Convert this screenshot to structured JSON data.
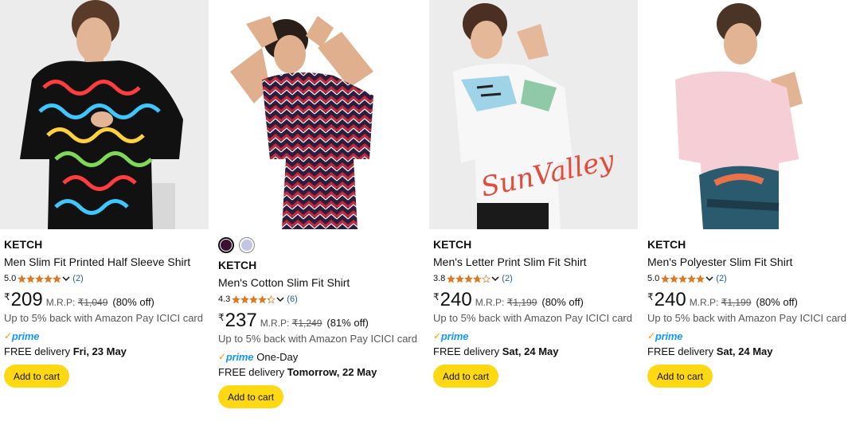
{
  "colors": {
    "accent_button": "#ffd814",
    "prime_blue": "#1399ff",
    "prime_tick": "#ff9900",
    "star": "#de7921",
    "link": "#2162a1"
  },
  "products": [
    {
      "brand": "KETCH",
      "title": "Men Slim Fit Printed Half Sleeve Shirt",
      "rating": "5.0",
      "rating_value": 5.0,
      "rating_count": "(2)",
      "currency": "₹",
      "price": "209",
      "mrp_label": "M.R.P:",
      "mrp": "₹1,049",
      "discount": "(80% off)",
      "cashback": "Up to 5% back with Amazon Pay ICICI card",
      "prime": "prime",
      "prime_extra": "",
      "delivery_prefix": "FREE delivery",
      "delivery_date": "Fri, 23 May",
      "button": "Add to cart",
      "image_icon": "shirt-photo-multicolor-squiggle"
    },
    {
      "brand": "KETCH",
      "title": "Men's Cotton Slim Fit Shirt",
      "rating": "4.3",
      "rating_value": 4.3,
      "rating_count": "(6)",
      "currency": "₹",
      "price": "237",
      "mrp_label": "M.R.P:",
      "mrp": "₹1,249",
      "discount": "(81% off)",
      "cashback": "Up to 5% back with Amazon Pay ICICI card",
      "prime": "prime",
      "prime_extra": "One-Day",
      "delivery_prefix": "FREE delivery",
      "delivery_date": "Tomorrow, 22 May",
      "button": "Add to cart",
      "swatch_colors": [
        "#3b1030",
        "#c3c6e0"
      ],
      "image_icon": "shirt-photo-maroon-chevron"
    },
    {
      "brand": "KETCH",
      "title": "Men's Letter Print Slim Fit Shirt",
      "rating": "3.8",
      "rating_value": 3.8,
      "rating_count": "(2)",
      "currency": "₹",
      "price": "240",
      "mrp_label": "M.R.P:",
      "mrp": "₹1,199",
      "discount": "(80% off)",
      "cashback": "Up to 5% back with Amazon Pay ICICI card",
      "prime": "prime",
      "prime_extra": "",
      "delivery_prefix": "FREE delivery",
      "delivery_date": "Sat, 24 May",
      "button": "Add to cart",
      "image_icon": "shirt-photo-white-letter-print"
    },
    {
      "brand": "KETCH",
      "title": "Men's Polyester Slim Fit Shirt",
      "rating": "5.0",
      "rating_value": 5.0,
      "rating_count": "(2)",
      "currency": "₹",
      "price": "240",
      "mrp_label": "M.R.P:",
      "mrp": "₹1,199",
      "discount": "(80% off)",
      "cashback": "Up to 5% back with Amazon Pay ICICI card",
      "prime": "prime",
      "prime_extra": "",
      "delivery_prefix": "FREE delivery",
      "delivery_date": "Sat, 24 May",
      "button": "Add to cart",
      "image_icon": "shirt-photo-pink-landscape"
    }
  ]
}
